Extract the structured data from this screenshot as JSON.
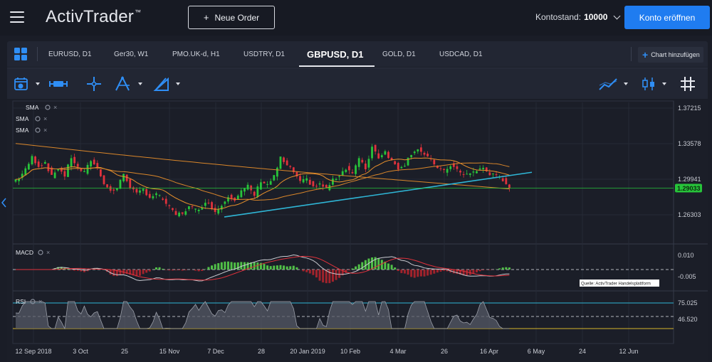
{
  "header": {
    "logo": "ActivTrader",
    "logo_tm": "™",
    "new_order_label": "Neue Order",
    "balance_label": "Kontostand:",
    "balance_value": "10000",
    "open_account_label": "Konto eröffnen"
  },
  "tabs": [
    {
      "label": "EURUSD, D1"
    },
    {
      "label": "Ger30, W1"
    },
    {
      "label": "PMO.UK-d, H1"
    },
    {
      "label": "USDTRY, D1"
    },
    {
      "label": "GBPUSD, D1",
      "active": true
    },
    {
      "label": "GOLD, D1"
    },
    {
      "label": "USDCAD, D1"
    }
  ],
  "add_chart_label": "Chart hinzufügen",
  "toolbar": {
    "left_icons": [
      "calendar-icon",
      "ruler-icon",
      "crosshair-icon",
      "fibonacci-icon",
      "drawing-icon"
    ],
    "right_icons": [
      "chart-line-icon",
      "candlestick-icon",
      "grid-icon"
    ]
  },
  "indicators": {
    "main": [
      "SMA",
      "SMA",
      "SMA"
    ],
    "macd": "MACD",
    "rsi": "RSI"
  },
  "source_label": "Quelle: ActivTrader Handelsplattform",
  "colors": {
    "accent": "#1f7cf0",
    "bull": "#27c43a",
    "bear": "#e0323c",
    "sma_fast": "#e9912c",
    "sma_slow": "#d9862a",
    "trendline": "#2fb6d6",
    "price_line": "#27c43a"
  },
  "chart_data": {
    "type": "candlestick",
    "symbol": "GBPUSD, D1",
    "price_axis_ticks": [
      "1.37215",
      "1.33578",
      "1.29941",
      "1.26303"
    ],
    "current_price": "1.29033",
    "macd_axis_ticks": [
      "0.010",
      "-0.005"
    ],
    "rsi_axis_ticks": [
      "75.025",
      "46.520"
    ],
    "x_tick_labels": [
      "12 Sep 2018",
      "3 Oct",
      "25",
      "15 Nov",
      "7 Dec",
      "28",
      "20 Jan 2019",
      "10 Feb",
      "4 Mar",
      "26",
      "16 Apr",
      "6 May",
      "24",
      "12 Jun"
    ],
    "approx_close_path": [
      1.297,
      1.301,
      1.309,
      1.322,
      1.313,
      1.317,
      1.302,
      1.311,
      1.303,
      1.322,
      1.311,
      1.306,
      1.319,
      1.311,
      1.296,
      1.287,
      1.29,
      1.305,
      1.292,
      1.284,
      1.289,
      1.281,
      1.284,
      1.279,
      1.27,
      1.263,
      1.265,
      1.271,
      1.268,
      1.272,
      1.276,
      1.266,
      1.273,
      1.283,
      1.279,
      1.287,
      1.292,
      1.283,
      1.298,
      1.294,
      1.302,
      1.321,
      1.313,
      1.307,
      1.296,
      1.299,
      1.292,
      1.294,
      1.29,
      1.298,
      1.304,
      1.311,
      1.306,
      1.32,
      1.31,
      1.333,
      1.322,
      1.328,
      1.318,
      1.311,
      1.315,
      1.326,
      1.331,
      1.324,
      1.318,
      1.312,
      1.307,
      1.314,
      1.309,
      1.303,
      1.306,
      1.308,
      1.311,
      1.305,
      1.302,
      1.299,
      1.291
    ],
    "sma_periods_note": "",
    "rsi_levels": [
      75.025,
      46.52
    ]
  }
}
